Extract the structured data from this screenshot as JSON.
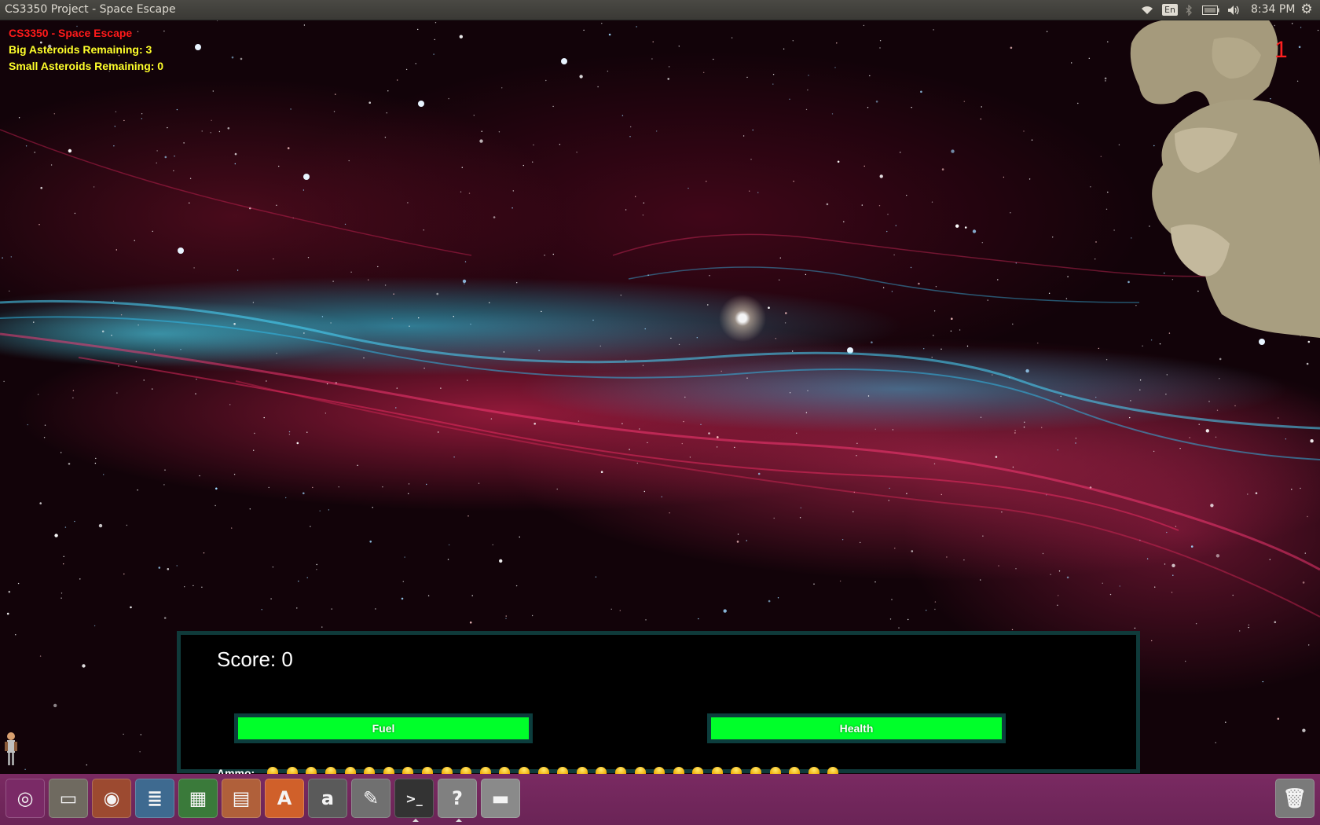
{
  "window": {
    "title": "CS3350 Project - Space Escape"
  },
  "top_panel": {
    "keyboard_layout": "En",
    "clock": "8:34 PM",
    "indicators": [
      "wifi-icon",
      "keyboard-layout-indicator",
      "bluetooth-icon",
      "battery-icon",
      "volume-icon",
      "settings-gear-icon"
    ]
  },
  "hud": {
    "game_title": "CS3350 - Space Escape",
    "big_asteroids": "Big Asteroids Remaining: 3",
    "small_asteroids": "Small Asteroids Remaining: 0",
    "lives": "1"
  },
  "status_panel": {
    "score": "Score: 0",
    "fuel_label": "Fuel",
    "fuel_level": 1.0,
    "health_label": "Health",
    "health_level": 1.0,
    "ammo_label": "Ammo:",
    "ammo_count": 30
  },
  "colors": {
    "hud_title": "#ff1a1a",
    "hud_text": "#ffff2a",
    "bar_fill": "#00ff2a",
    "panel_border": "#0f3a3a",
    "launcher": "#6a2456"
  },
  "launcher": {
    "items": [
      {
        "name": "ubuntu-dash-icon",
        "bg": "#7a2a66"
      },
      {
        "name": "files-icon",
        "bg": "#6f6a60"
      },
      {
        "name": "firefox-icon",
        "bg": "#9c4a30"
      },
      {
        "name": "writer-icon",
        "bg": "#3e6a90"
      },
      {
        "name": "calc-icon",
        "bg": "#3a7a3a"
      },
      {
        "name": "impress-icon",
        "bg": "#b0603a"
      },
      {
        "name": "software-center-icon",
        "bg": "#d0602a"
      },
      {
        "name": "amazon-icon",
        "bg": "#5a5a5a"
      },
      {
        "name": "system-settings-icon",
        "bg": "#707070"
      },
      {
        "name": "terminal-icon",
        "bg": "#333333"
      },
      {
        "name": "help-icon",
        "bg": "#808080"
      },
      {
        "name": "drive-icon",
        "bg": "#8a8a8a"
      },
      {
        "name": "trash-icon",
        "bg": "#7a7a7a"
      }
    ]
  }
}
